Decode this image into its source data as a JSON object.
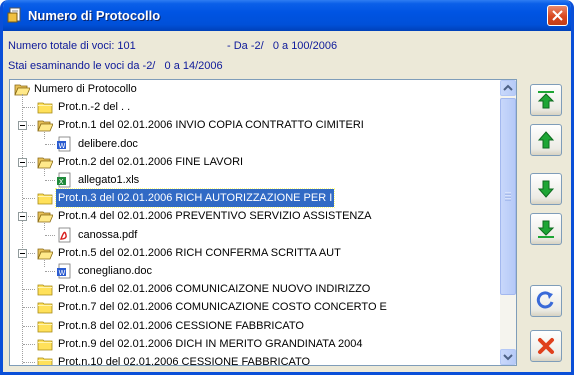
{
  "window": {
    "title": "Numero di Protocollo"
  },
  "info": {
    "total": "Numero totale di voci: 101",
    "range": "- Da -2/   0 a 100/2006",
    "examining": "Stai esaminando le voci da -2/   0 a 14/2006"
  },
  "tree": {
    "root": "Numero di Protocollo",
    "items": [
      {
        "label": "Prot.n.-2 del   . ."
      },
      {
        "label": "Prot.n.1 del 02.01.2006 INVIO COPIA CONTRATTO CIMITERI",
        "expanded": true
      },
      {
        "label": "delibere.doc",
        "icon": "word-doc-icon"
      },
      {
        "label": "Prot.n.2 del 02.01.2006 FINE LAVORI",
        "expanded": true
      },
      {
        "label": "allegato1.xls",
        "icon": "excel-file-icon"
      },
      {
        "label": "Prot.n.3 del 02.01.2006 RICH  AUTORIZZAZIONE  PER  I",
        "selected": true
      },
      {
        "label": "Prot.n.4 del 02.01.2006 PREVENTIVO SERVIZIO ASSISTENZA",
        "expanded": true
      },
      {
        "label": "canossa.pdf",
        "icon": "pdf-file-icon"
      },
      {
        "label": "Prot.n.5 del 02.01.2006 RICH   CONFERMA   SCRITTA  AUT",
        "expanded": true
      },
      {
        "label": "conegliano.doc",
        "icon": "word-doc-icon"
      },
      {
        "label": "Prot.n.6 del 02.01.2006 COMUNICAIZONE NUOVO INDIRIZZO"
      },
      {
        "label": "Prot.n.7 del 02.01.2006 COMUNICAZIONE COSTO CONCERTO E"
      },
      {
        "label": "Prot.n.8 del 02.01.2006 CESSIONE FABBRICATO"
      },
      {
        "label": "Prot.n.9 del 02.01.2006 DICH IN MERITO GRANDINATA 2004"
      },
      {
        "label": "Prot.n.10 del 02.01.2006 CESSIONE FABBRICATO"
      }
    ]
  },
  "buttons": [
    {
      "name": "move-to-top-button",
      "icon": "arrow-top-icon"
    },
    {
      "name": "move-up-button",
      "icon": "arrow-up-icon"
    },
    {
      "name": "move-down-button",
      "icon": "arrow-down-icon"
    },
    {
      "name": "move-to-bottom-button",
      "icon": "arrow-bottom-icon"
    },
    {
      "name": "refresh-button",
      "icon": "refresh-icon"
    },
    {
      "name": "delete-button",
      "icon": "delete-x-icon"
    }
  ],
  "colors": {
    "titlebar": "#0054e3",
    "info_text": "#0e1a9a",
    "selection": "#316ac5",
    "arrow_green": "#1ea635",
    "delete_red": "#e0401c"
  }
}
